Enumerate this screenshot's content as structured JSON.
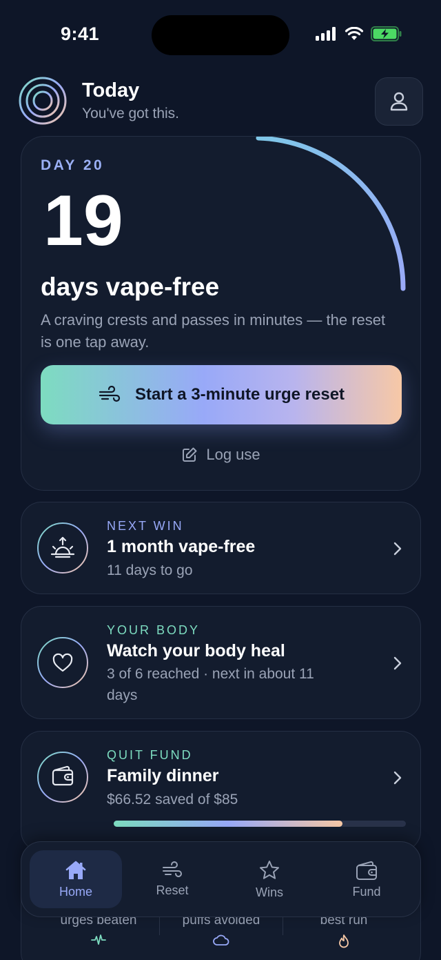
{
  "status_bar": {
    "time": "9:41"
  },
  "header": {
    "title": "Today",
    "subtitle": "You've got this."
  },
  "hero": {
    "day_label": "DAY 20",
    "count": "19",
    "count_label": "days vape-free",
    "description": "A craving crests and passes in minutes — the reset is one tap away.",
    "cta_label": "Start a 3-minute urge reset",
    "log_label": "Log use"
  },
  "cards": [
    {
      "kicker": "NEXT WIN",
      "title": "1 month vape-free",
      "sub": "11 days to go",
      "icon": "sunrise-icon"
    },
    {
      "kicker": "YOUR BODY",
      "title": "Watch your body heal",
      "sub": "3 of 6 reached · next in about 11 days",
      "icon": "heart-icon"
    },
    {
      "kicker": "QUIT FUND",
      "title": "Family dinner",
      "sub": "$66.52 saved of $85",
      "icon": "wallet-icon",
      "progress": 0.7826
    }
  ],
  "stats": [
    {
      "label": "urges beaten",
      "icon": "pulse-icon"
    },
    {
      "label": "puffs avoided",
      "icon": "cloud-icon"
    },
    {
      "label": "best run",
      "icon": "flame-icon"
    }
  ],
  "tabs": [
    {
      "label": "Home",
      "icon": "home-icon",
      "active": true
    },
    {
      "label": "Reset",
      "icon": "wind-icon",
      "active": false
    },
    {
      "label": "Wins",
      "icon": "star-icon",
      "active": false
    },
    {
      "label": "Fund",
      "icon": "wallet-icon",
      "active": false
    }
  ],
  "colors": {
    "background": "#0e1628",
    "card": "#131c2e",
    "accent_blue": "#98a9f8",
    "accent_teal": "#7ddcc0",
    "accent_peach": "#f7c8a6",
    "muted_text": "#9aa3b6"
  }
}
